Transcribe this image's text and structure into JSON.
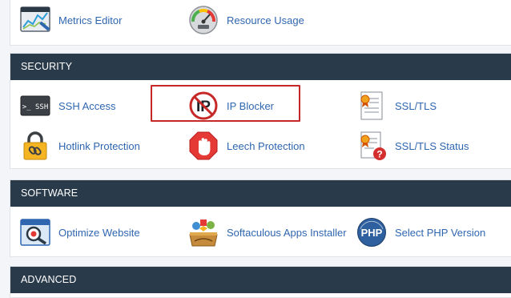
{
  "top_items": [
    {
      "label": "Metrics Editor",
      "icon": "metrics-editor-icon"
    },
    {
      "label": "Resource Usage",
      "icon": "resource-usage-icon"
    }
  ],
  "security": {
    "title": "SECURITY",
    "items": [
      {
        "label": "SSH Access",
        "icon": "ssh-icon"
      },
      {
        "label": "IP Blocker",
        "icon": "ip-blocker-icon"
      },
      {
        "label": "SSL/TLS",
        "icon": "ssl-certificate-icon"
      },
      {
        "label": "Hotlink Protection",
        "icon": "padlock-icon"
      },
      {
        "label": "Leech Protection",
        "icon": "stop-hand-icon"
      },
      {
        "label": "SSL/TLS Status",
        "icon": "ssl-status-icon"
      }
    ],
    "ssh_icon_text": ">_ SSH",
    "ip_icon_text": "IP"
  },
  "software": {
    "title": "SOFTWARE",
    "items": [
      {
        "label": "Optimize Website",
        "icon": "optimize-website-icon"
      },
      {
        "label": "Softaculous Apps Installer",
        "icon": "softaculous-icon"
      },
      {
        "label": "Select PHP Version",
        "icon": "php-icon"
      }
    ],
    "php_icon_text": "PHP"
  },
  "advanced": {
    "title": "ADVANCED"
  },
  "colors": {
    "header_bg": "#293a4a",
    "link": "#2f66b0",
    "highlight": "#c62828"
  }
}
